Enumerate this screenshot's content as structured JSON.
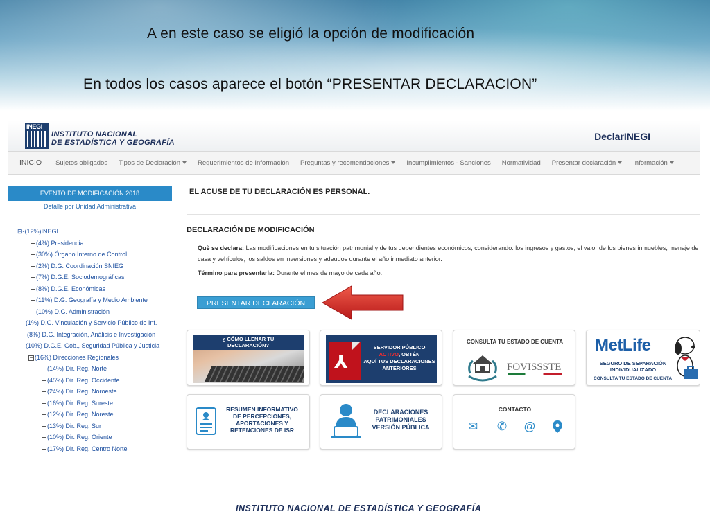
{
  "slide": {
    "line1": "A en este caso se eligió la opción de modificación",
    "line2": "En todos los casos aparece el botón “PRESENTAR DECLARACION”",
    "footer": "INSTITUTO NACIONAL  DE ESTADÍSTICA Y GEOGRAFÍA"
  },
  "header": {
    "logo_text": "INEGI",
    "institute_line1": "INSTITUTO NACIONAL",
    "institute_line2": "DE ESTADÍSTICA Y GEOGRAFÍA",
    "app_name": "DeclarINEGI"
  },
  "nav": {
    "items": [
      "INICIO",
      "Sujetos obligados",
      "Tipos de Declaración",
      "Requerimientos de Información",
      "Preguntas y recomendaciones",
      "Incumplimientos - Sanciones",
      "Normatividad",
      "Presentar declaración",
      "Información"
    ]
  },
  "sidebar": {
    "header": "EVENTO DE MODIFICACIÓN 2018",
    "subheader": "Detalle por Unidad Administrativa",
    "tree": [
      "⊟-(12%)INEGI",
      "(4%) Presidencia",
      "(30%) Órgano Interno de Control",
      "(2%) D.G. Coordinación SNIEG",
      "(7%) D.G.E. Sociodemográficas",
      "(8%) D.G.E. Económicas",
      "(11%) D.G. Geografía y Medio Ambiente",
      "(10%) D.G. Administración",
      "(1%) D.G. Vinculación y Servicio Público de Inf.",
      "(8%) D.G. Integración, Análisis e Investigación",
      "(10%) D.G.E. Gob., Seguridad Pública y Justicia",
      "(16%) Direcciones Regionales",
      "(14%) Dir. Reg. Norte",
      "(45%) Dir. Reg. Occidente",
      "(24%) Dir. Reg. Noroeste",
      "(16%) Dir. Reg. Sureste",
      "(12%) Dir. Reg. Noreste",
      "(13%) Dir. Reg. Sur",
      "(10%) Dir. Reg. Oriente",
      "(17%) Dir. Reg. Centro Norte"
    ]
  },
  "main": {
    "acuse": "EL ACUSE DE TU DECLARACIÓN ES PERSONAL.",
    "title": "DECLARACIÓN DE MODIFICACIÓN",
    "que_label": "Què se declara:",
    "que_text": " Las modificaciones en tu situación patrimonial y de tus dependientes económicos, considerando: los ingresos y gastos; el valor de los bienes inmuebles, menaje de casa y vehículos; los saldos en inversiones y adeudos durante el año inmediato anterior.",
    "termino_label": "Término para presentarla:",
    "termino_text": " Durante el mes de mayo de cada año.",
    "button": "PRESENTAR DECLARACIÓN"
  },
  "cards": {
    "llenar": {
      "l1": "¿ CÓMO LLENAR TU",
      "l2": "DECLARACIÓN?"
    },
    "servidor": {
      "l1": "SERVIDOR PÚBLICO",
      "l2a": "ACTIVO",
      "l2b": ", OBTÉN",
      "l3a": "AQUÍ",
      "l3b": " TUS DECLARACIONES",
      "l4": "ANTERIORES"
    },
    "consulta": {
      "title": "CONSULTA TU ESTADO DE CUENTA",
      "brand": "FOVISSSTE"
    },
    "metlife": {
      "brand": "MetLife",
      "l1": "SEGURO DE SEPARACIÓN",
      "l2": "INDIVIDUALIZADO",
      "l3": "CONSULTA TU ESTADO DE CUENTA"
    },
    "resumen": {
      "l1": "RESUMEN INFORMATIVO",
      "l2": "DE PERCEPCIONES,",
      "l3": "APORTACIONES Y",
      "l4": "RETENCIONES DE ISR"
    },
    "publica": {
      "l1": "DECLARACIONES",
      "l2": "PATRIMONIALES",
      "l3": "VERSIÓN PÚBLICA"
    },
    "contacto": {
      "title": "CONTACTO"
    }
  },
  "colors": {
    "accent": "#2a8ac8",
    "brand_dark": "#1d3e6e",
    "arrow": "#d42a2a"
  }
}
